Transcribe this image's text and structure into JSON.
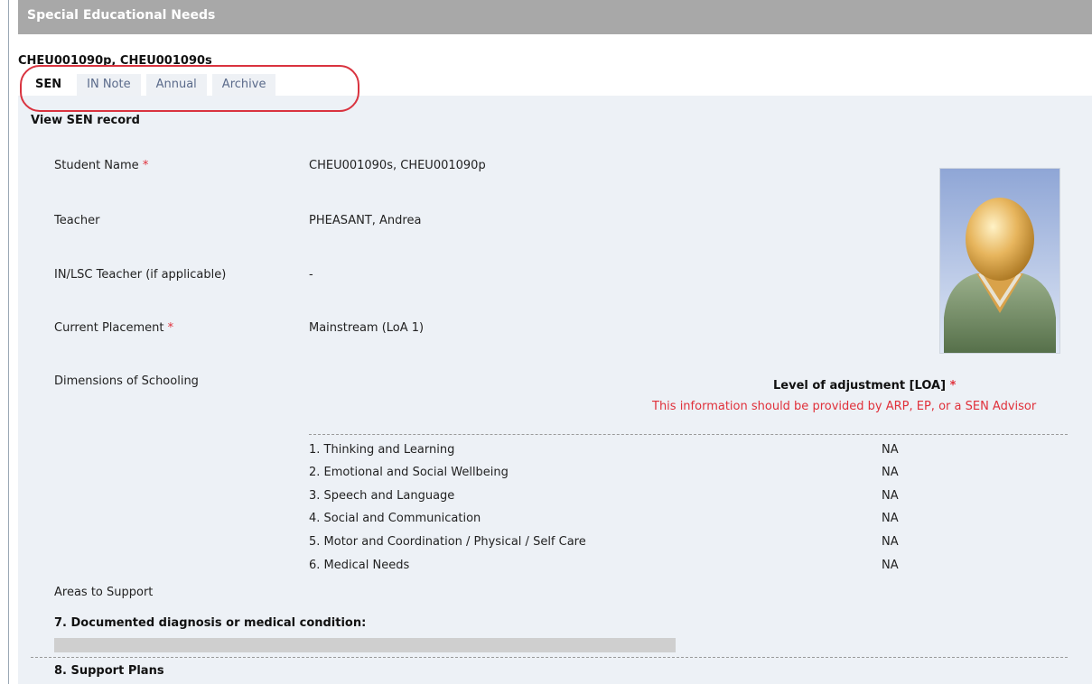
{
  "header": {
    "title": "Special Educational Needs"
  },
  "student_ids": "CHEU001090p, CHEU001090s",
  "tabs": [
    {
      "label": "SEN",
      "active": true
    },
    {
      "label": "IN Note",
      "active": false
    },
    {
      "label": "Annual",
      "active": false
    },
    {
      "label": "Archive",
      "active": false
    }
  ],
  "section_title": "View SEN record",
  "fields": {
    "student_name": {
      "label": "Student Name",
      "required": "*",
      "value": "CHEU001090s, CHEU001090p"
    },
    "teacher": {
      "label": "Teacher",
      "value": "PHEASANT, Andrea"
    },
    "in_lsc_teacher": {
      "label": "IN/LSC Teacher (if applicable)",
      "value": "-"
    },
    "current_placement": {
      "label": "Current Placement",
      "required": "*",
      "value": "Mainstream (LoA 1)"
    },
    "dimensions_of_schooling": {
      "label": "Dimensions of Schooling"
    }
  },
  "loa": {
    "heading": "Level of adjustment [LOA]",
    "required": "*",
    "note": "This information should be provided by ARP, EP, or a SEN Advisor"
  },
  "dimensions": [
    {
      "label": "1. Thinking and Learning",
      "value": "NA"
    },
    {
      "label": "2. Emotional and Social Wellbeing",
      "value": "NA"
    },
    {
      "label": "3. Speech and Language",
      "value": "NA"
    },
    {
      "label": "4. Social and Communication",
      "value": "NA"
    },
    {
      "label": "5. Motor and Coordination / Physical / Self Care",
      "value": "NA"
    },
    {
      "label": "6. Medical Needs",
      "value": "NA"
    }
  ],
  "areas_to_support": "Areas to Support",
  "documented_diagnosis": "7. Documented diagnosis or medical condition:",
  "support_plans": "8. Support Plans",
  "colors": {
    "header_bg": "#a8a8a8",
    "panel_bg": "#edf1f6",
    "required": "#e0303a",
    "highlight": "#d9333f"
  }
}
